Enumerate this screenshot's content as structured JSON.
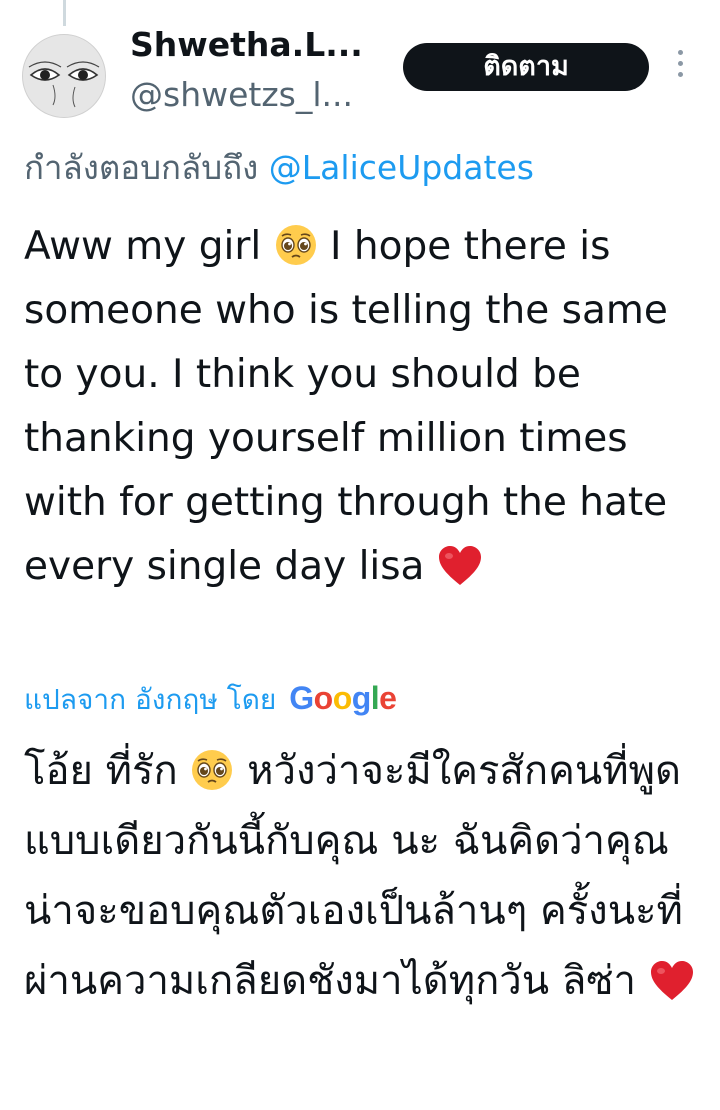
{
  "author": {
    "display_name": "Shwetha.L...",
    "handle": "@shwetzs_l..."
  },
  "follow_button": {
    "label": "ติดตาม"
  },
  "more_menu": {
    "icon": "more-vertical-icon"
  },
  "reply_context": {
    "prefix": "กำลังตอบกลับถึง",
    "mention": "@LaliceUpdates"
  },
  "tweet": {
    "text_before_emoji": "Aww my girl",
    "emoji_1": "pleading-face-emoji",
    "text_after_emoji": "I hope there is someone who is telling the same to you. I think you should be thanking yourself million times with for getting through the hate every single day lisa",
    "emoji_2": "red-heart-emoji"
  },
  "translation_credit": {
    "label": "แปลจาก อังกฤษ โดย",
    "provider_letters": [
      "G",
      "o",
      "o",
      "g",
      "l",
      "e"
    ]
  },
  "translation": {
    "text_before_emoji": "โอ้ย ที่รัก",
    "emoji_1": "pleading-face-emoji",
    "text_after_emoji": "หวังว่าจะมีใครสักคนที่พูดแบบเดียวกันนี้กับคุณ นะ ฉันคิดว่าคุณน่าจะขอบคุณตัวเองเป็นล้านๆ ครั้งนะที่ผ่านความเกลียดชังมาได้ทุกวัน ลิซ่า",
    "emoji_2": "red-heart-emoji"
  },
  "colors": {
    "link_blue": "#1d9bf0",
    "secondary_text": "#536471",
    "primary_text": "#0f1419",
    "button_bg": "#0f1419",
    "heart_red": "#e0202e",
    "emoji_yellow": "#ffcc4d"
  }
}
